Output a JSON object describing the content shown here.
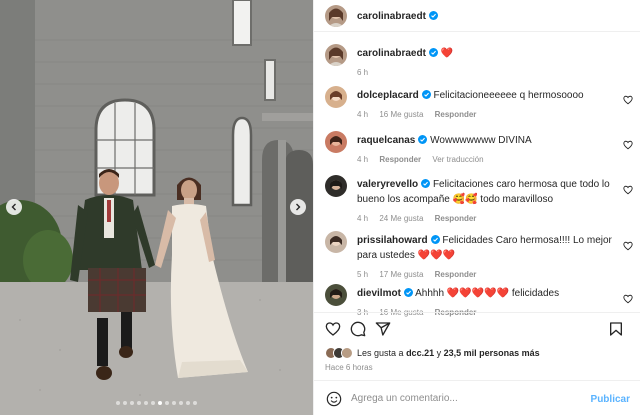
{
  "post": {
    "author": "carolinabraedt",
    "caption_user": "carolinabraedt",
    "caption_text": "❤️",
    "caption_time": "6 h"
  },
  "carousel": {
    "prev_icon": "chevron-left-icon",
    "next_icon": "chevron-right-icon",
    "slide_count": 12,
    "active_slide": 6
  },
  "comments": [
    {
      "user": "dolceplacard",
      "text": "Felicitacioneeeeee q hermosoooo",
      "time": "4 h",
      "likes": "16 Me gusta",
      "reply": "Responder",
      "translate": ""
    },
    {
      "user": "raquelcanas",
      "text": "Wowwwwwww DIVINA",
      "time": "4 h",
      "likes": "",
      "reply": "Responder",
      "translate": "Ver traducción"
    },
    {
      "user": "valeryrevello",
      "text": "Felicitaciones caro hermosa que todo lo bueno los acompañe 🥰🥰 todo maravilloso",
      "time": "4 h",
      "likes": "24 Me gusta",
      "reply": "Responder",
      "translate": ""
    },
    {
      "user": "prissilahoward",
      "text": "Felicidades Caro hermosa!!!! Lo mejor para ustedes ❤️❤️❤️",
      "time": "5 h",
      "likes": "17 Me gusta",
      "reply": "Responder",
      "translate": ""
    },
    {
      "user": "dievilmot",
      "text": "Ahhhh ❤️❤️❤️❤️❤️ felicidades",
      "time": "3 h",
      "likes": "16 Me gusta",
      "reply": "Responder",
      "translate": ""
    }
  ],
  "likes_summary": {
    "prefix": "Les gusta a",
    "user": "dcc.21",
    "middle": "y",
    "count": "23,5 mil personas más"
  },
  "posted_ago": "Hace 6 horas",
  "composer": {
    "placeholder": "Agrega un comentario...",
    "post_label": "Publicar"
  },
  "colors": {
    "verified": "#0095f6",
    "heart": "#ed4956",
    "link": "#5ab3ff",
    "muted": "#8e8e8e"
  }
}
